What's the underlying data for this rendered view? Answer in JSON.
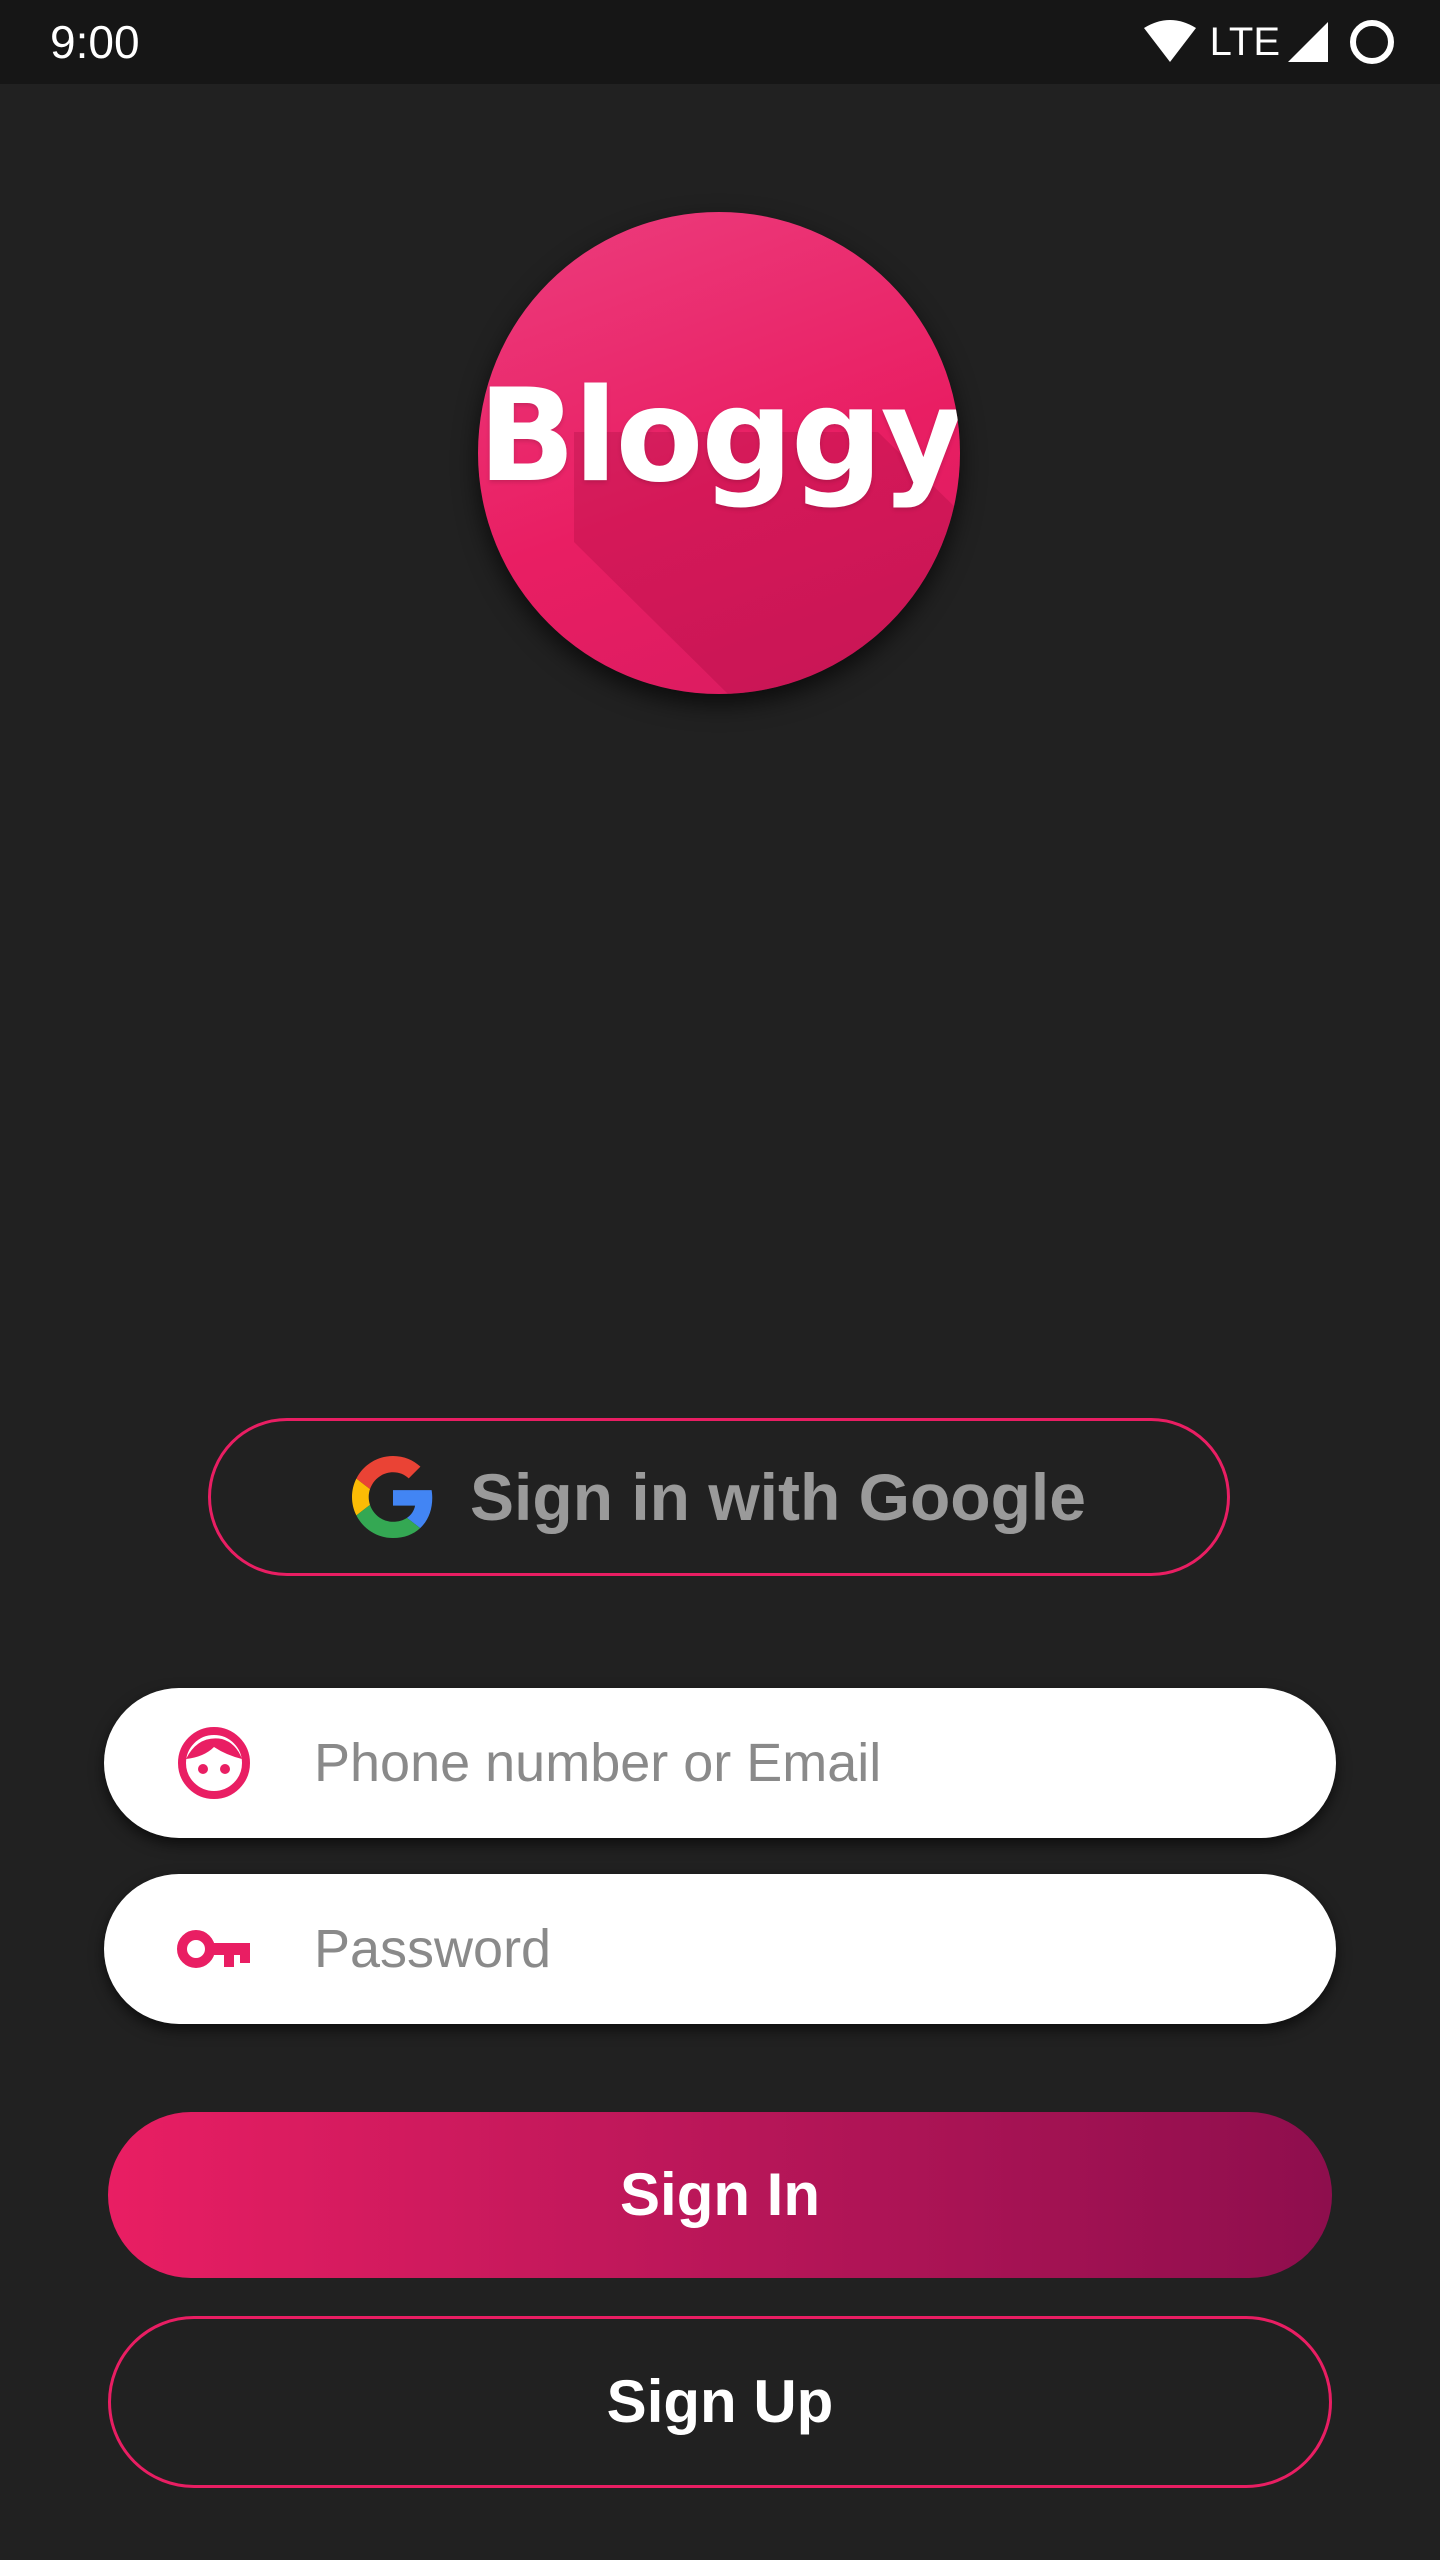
{
  "status_bar": {
    "time": "9:00",
    "network": "LTE",
    "icons": [
      "wifi-icon",
      "cell-signal-icon",
      "battery-icon"
    ]
  },
  "logo": {
    "text": "Bloggy"
  },
  "google_button": {
    "label": "Sign in with Google",
    "icon": "google-icon"
  },
  "form": {
    "email": {
      "placeholder": "Phone number or Email",
      "value": "",
      "icon": "face-icon"
    },
    "password": {
      "placeholder": "Password",
      "value": "",
      "icon": "key-icon"
    }
  },
  "actions": {
    "sign_in_label": "Sign In",
    "sign_up_label": "Sign Up"
  },
  "colors": {
    "background": "#212121",
    "status_bar": "#161616",
    "accent": "#e91e63",
    "accent_dark": "#8e0e4d",
    "field_background": "#ffffff",
    "placeholder": "#8a8a8a"
  }
}
